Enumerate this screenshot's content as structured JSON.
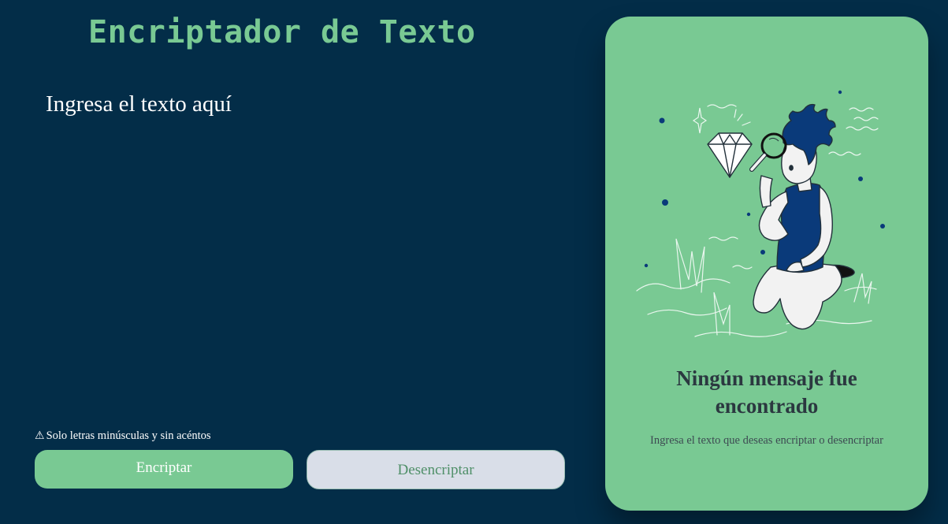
{
  "app": {
    "title": "Encriptador de Texto"
  },
  "input": {
    "placeholder": "Ingresa el texto aquí",
    "value": ""
  },
  "hint": {
    "icon": "warning-icon",
    "glyph": "⚠",
    "text": "Solo letras minúsculas y sin acéntos"
  },
  "buttons": {
    "encrypt_label": "Encriptar",
    "decrypt_label": "Desencriptar"
  },
  "output_panel": {
    "illustration": "person-inspecting-diamond-with-magnifier",
    "title": "Ningún mensaje fue encontrado",
    "subtitle": "Ingresa el texto que deseas encriptar o desencriptar"
  },
  "colors": {
    "background": "#032d48",
    "accent": "#79c993",
    "secondary_button": "#d9dee8",
    "character_shirt": "#0a3a7a",
    "text_dark": "#2b3840"
  }
}
